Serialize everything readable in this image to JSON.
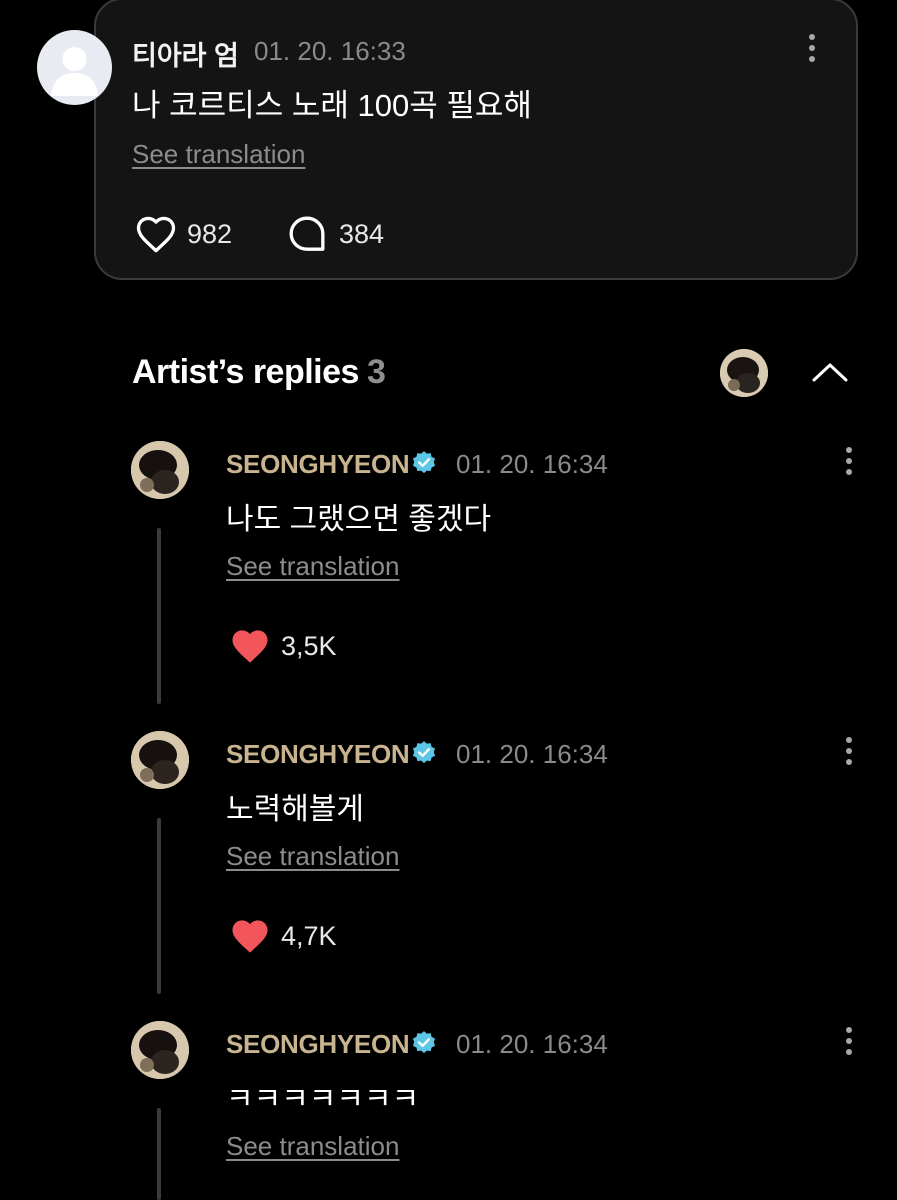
{
  "post": {
    "author": "티아라 엄",
    "timestamp": "01. 20. 16:33",
    "text": "나 코르티스 노래 100곡 필요해",
    "see_translation": "See translation",
    "likes": "982",
    "comments": "384"
  },
  "replies_header": {
    "title": "Artist’s replies",
    "count": "3"
  },
  "replies": [
    {
      "name": "SEONGHYEON",
      "timestamp": "01. 20. 16:34",
      "text": "나도 그랬으면 좋겠다",
      "see_translation": "See translation",
      "likes": "3,5K"
    },
    {
      "name": "SEONGHYEON",
      "timestamp": "01. 20. 16:34",
      "text": "노력해볼게",
      "see_translation": "See translation",
      "likes": "4,7K"
    },
    {
      "name": "SEONGHYEON",
      "timestamp": "01. 20. 16:34",
      "text": "ㅋㅋㅋㅋㅋㅋㅋ",
      "see_translation": "See translation"
    }
  ],
  "icons": {
    "like": "heart-outline-icon",
    "liked": "heart-filled-icon",
    "comment": "comment-bubble-icon",
    "more": "more-vertical-icon",
    "verified": "verified-badge-icon",
    "collapse": "chevron-up-icon"
  },
  "colors": {
    "background": "#000000",
    "card": "#141414",
    "artist_name": "#c8b48e",
    "heart": "#f2555a",
    "verified": "#5cc6e6"
  }
}
